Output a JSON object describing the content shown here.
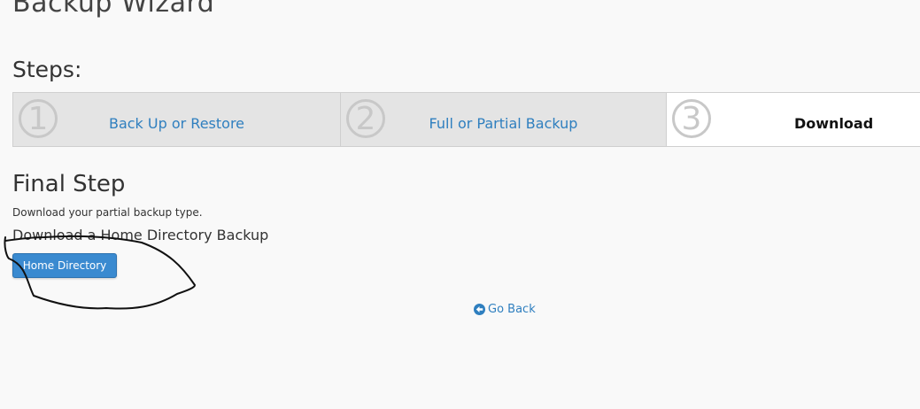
{
  "page": {
    "title": "Backup Wizard"
  },
  "steps": {
    "heading": "Steps:",
    "items": [
      {
        "number": "1",
        "label": "Back Up or Restore"
      },
      {
        "number": "2",
        "label": "Full or Partial Backup"
      },
      {
        "number": "3",
        "label": "Download"
      }
    ]
  },
  "final": {
    "title": "Final Step",
    "description": "Download your partial backup type.",
    "subheading": "Download a Home Directory Backup",
    "button_label": "Home Directory"
  },
  "nav": {
    "go_back_label": "Go Back",
    "go_back_icon": "circle-arrow-left-icon"
  },
  "colors": {
    "link": "#2f7fbf",
    "button": "#3a8ad0",
    "active_step_bg": "#ffffff",
    "inactive_step_bg": "#e4e4e4"
  }
}
